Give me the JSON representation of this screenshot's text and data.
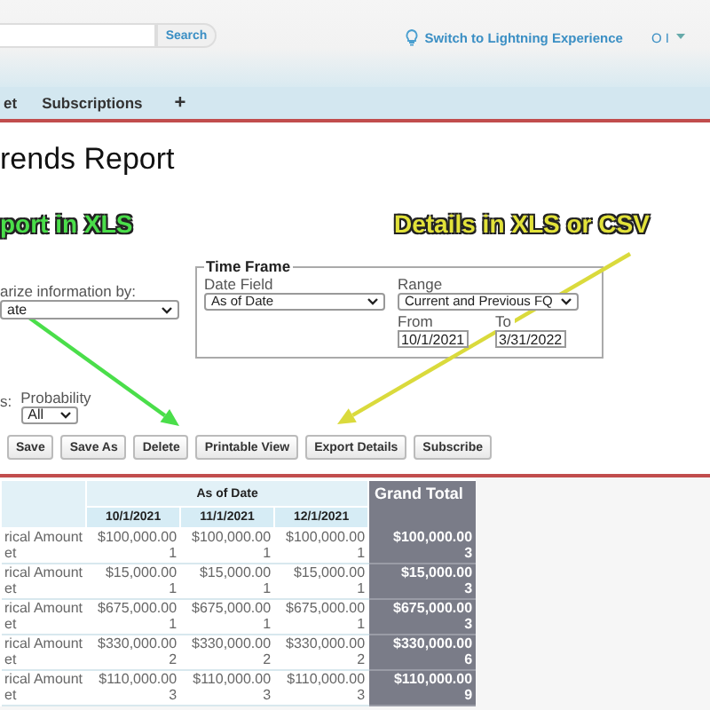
{
  "header": {
    "search_button": "Search",
    "lightning_link": "Switch to Lightning Experience",
    "user_menu": "O I"
  },
  "tabs": [
    {
      "label": "et",
      "selected": false
    },
    {
      "label": "Subscriptions",
      "selected": false
    }
  ],
  "add_tab": "+",
  "title": "rends Report",
  "annotations": [
    {
      "text": "port in XLS",
      "color": "#4ade4a"
    },
    {
      "text": "Details in XLS or CSV",
      "color": "#e2e23a"
    }
  ],
  "summarize": {
    "label": "arize information by:",
    "value": "ate"
  },
  "time_frame": {
    "legend": "Time Frame",
    "date_field": {
      "label": "Date Field",
      "value": "As of Date"
    },
    "range": {
      "label": "Range",
      "value": "Current and Previous FQ"
    },
    "from": {
      "label": "From",
      "value": "10/1/2021"
    },
    "to": {
      "label": "To",
      "value": "3/31/2022"
    }
  },
  "filters": {
    "cut_label": "s:",
    "probability": {
      "label": "Probability",
      "value": "All"
    }
  },
  "buttons": [
    "Save",
    "Save As",
    "Delete",
    "Printable View",
    "Export Details",
    "Subscribe"
  ],
  "table": {
    "group_header": "As of Date",
    "columns": [
      "10/1/2021",
      "11/1/2021",
      "12/1/2021"
    ],
    "total_header": "Grand Total",
    "rows": [
      {
        "label": "rical Amount\net",
        "cells": [
          "$100,000.00\n1",
          "$100,000.00\n1",
          "$100,000.00\n1"
        ],
        "total": "$100,000.00\n3"
      },
      {
        "label": "rical Amount\net",
        "cells": [
          "$15,000.00\n1",
          "$15,000.00\n1",
          "$15,000.00\n1"
        ],
        "total": "$15,000.00\n3"
      },
      {
        "label": "rical Amount\net",
        "cells": [
          "$675,000.00\n1",
          "$675,000.00\n1",
          "$675,000.00\n1"
        ],
        "total": "$675,000.00\n3"
      },
      {
        "label": "rical Amount\net",
        "cells": [
          "$330,000.00\n2",
          "$330,000.00\n2",
          "$330,000.00\n2"
        ],
        "total": "$330,000.00\n6"
      },
      {
        "label": "rical Amount\net",
        "cells": [
          "$110,000.00\n3",
          "$110,000.00\n3",
          "$110,000.00\n3"
        ],
        "total": "$110,000.00\n9"
      }
    ]
  }
}
